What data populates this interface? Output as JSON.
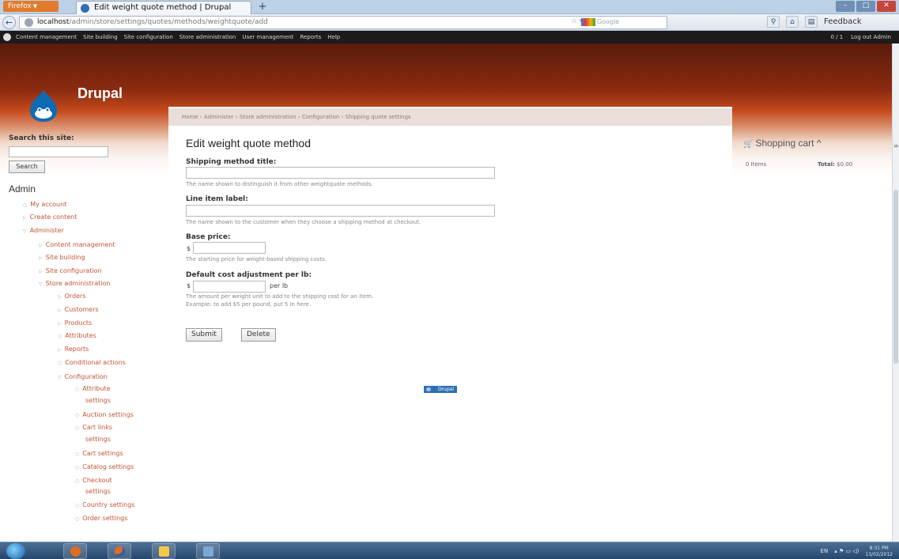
{
  "browser": {
    "app_button": "Firefox",
    "tab_title": "Edit weight quote method | Drupal",
    "new_tab": "+",
    "url_host": "localhost",
    "url_path": "/admin/store/settings/quotes/methods/weightquote/add",
    "search_placeholder": "Google",
    "feedback_label": "Feedback"
  },
  "admin_menu": {
    "items": [
      "Content management",
      "Site building",
      "Site configuration",
      "Store administration",
      "User management",
      "Reports",
      "Help"
    ],
    "user_count": "0 / 1",
    "logout": "Log out Admin"
  },
  "site": {
    "name": "Drupal"
  },
  "breadcrumb": "Home › Administer › Store administration › Configuration › Shipping quote settings",
  "page_title": "Edit weight quote method",
  "form": {
    "title_label": "Shipping method title:",
    "title_desc": "The name shown to distinguish it from other weightquote methods.",
    "line_label": "Line item label:",
    "line_desc": "The name shown to the customer when they choose a shipping method at checkout.",
    "base_label": "Base price:",
    "base_prefix": "$",
    "base_desc": "The starting price for weight-based shipping costs.",
    "adj_label": "Default cost adjustment per lb:",
    "adj_prefix": "$",
    "adj_suffix": "per lb",
    "adj_desc_1": "The amount per weight unit to add to the shipping cost for an item.",
    "adj_desc_2": "Example: to add $5 per pound, put 5 in here.",
    "submit": "Submit",
    "delete": "Delete"
  },
  "powered_by": "Drupal",
  "sidebar": {
    "search_label": "Search this site:",
    "search_button": "Search",
    "admin_title": "Admin",
    "menu": [
      {
        "label": "My account"
      },
      {
        "label": "Create content"
      },
      {
        "label": "Administer"
      },
      {
        "label": "Content management"
      },
      {
        "label": "Site building"
      },
      {
        "label": "Site configuration"
      },
      {
        "label": "Store administration"
      },
      {
        "label": "Orders"
      },
      {
        "label": "Customers"
      },
      {
        "label": "Products"
      },
      {
        "label": "Attributes"
      },
      {
        "label": "Reports"
      },
      {
        "label": "Conditional actions"
      },
      {
        "label": "Configuration"
      },
      {
        "label": "Attribute"
      },
      {
        "label": "settings"
      },
      {
        "label": "Auction settings"
      },
      {
        "label": "Cart links"
      },
      {
        "label": "settings"
      },
      {
        "label": "Cart settings"
      },
      {
        "label": "Catalog settings"
      },
      {
        "label": "Checkout"
      },
      {
        "label": "settings"
      },
      {
        "label": "Country settings"
      },
      {
        "label": "Order settings"
      }
    ]
  },
  "cart": {
    "title": "Shopping cart",
    "items": "0 Items",
    "total_label": "Total:",
    "total_value": "$0.00"
  },
  "taskbar": {
    "lang": "EN",
    "time": "8:31 PM",
    "date": "13/02/2012"
  }
}
